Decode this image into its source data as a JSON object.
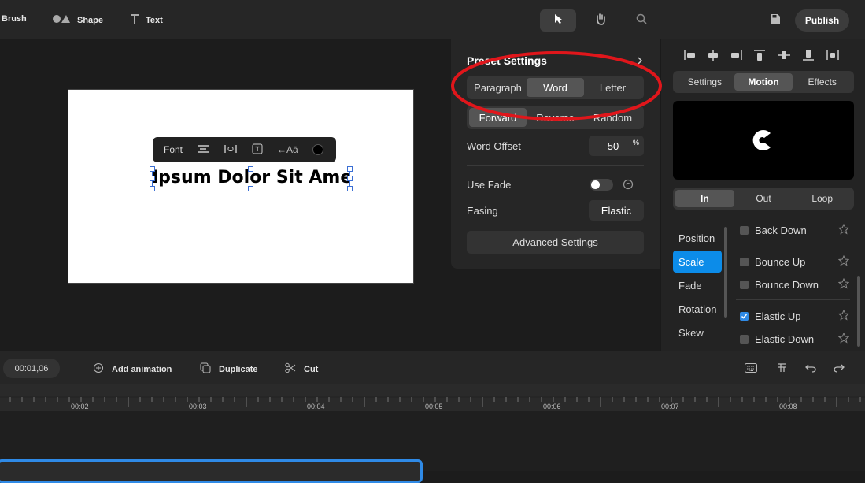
{
  "toolbar": {
    "brush_label": "Brush",
    "shape_label": "Shape",
    "text_label": "Text",
    "publish_label": "Publish"
  },
  "canvas": {
    "text": "Ipsum Dolor Sit Amet",
    "text_toolbar": {
      "font_label": "Font",
      "color": "#000000"
    }
  },
  "preset": {
    "title": "Preset Settings",
    "split_options": [
      "Paragraph",
      "Word",
      "Letter"
    ],
    "split_selected": "Word",
    "direction_options": [
      "Forward",
      "Reverse",
      "Random"
    ],
    "direction_selected": "Forward",
    "word_offset_label": "Word Offset",
    "word_offset_value": "50",
    "word_offset_unit": "%",
    "use_fade_label": "Use Fade",
    "use_fade_on": false,
    "easing_label": "Easing",
    "easing_value": "Elastic",
    "advanced_label": "Advanced Settings"
  },
  "right": {
    "tabs": [
      "Settings",
      "Motion",
      "Effects"
    ],
    "tab_selected": "Motion",
    "phase_tabs": [
      "In",
      "Out",
      "Loop"
    ],
    "phase_selected": "In",
    "categories": [
      "Position",
      "Scale",
      "Fade",
      "Rotation",
      "Skew"
    ],
    "category_selected": "Scale",
    "animations": [
      {
        "name": "Back Down",
        "checked": false
      },
      {
        "name": "Bounce Up",
        "checked": false
      },
      {
        "name": "Bounce Down",
        "checked": false
      },
      {
        "name": "Elastic Up",
        "checked": true
      },
      {
        "name": "Elastic Down",
        "checked": false
      }
    ]
  },
  "timeline": {
    "time": "00:01,06",
    "add_animation_label": "Add animation",
    "duplicate_label": "Duplicate",
    "cut_label": "Cut",
    "ticks": [
      "00:02",
      "00:03",
      "00:04",
      "00:05",
      "00:06",
      "00:07",
      "00:08"
    ]
  },
  "colors": {
    "accent": "#0c8ce9",
    "annotation": "#e0161b"
  }
}
